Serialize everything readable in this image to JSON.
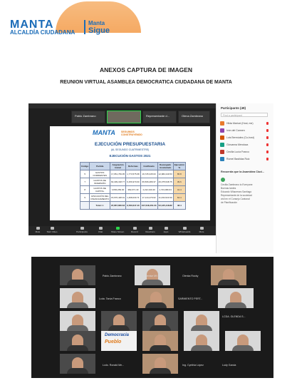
{
  "header": {
    "logo_text": "MANTA",
    "logo_sub": "ALCALDÍA CIUDADANA",
    "logo_tagline_1": "Manta",
    "logo_tagline_2": "Sigue"
  },
  "doc": {
    "title": "ANEXOS CAPTURA DE IMAGEN",
    "subtitle": "REUNION VIRTUAL ASAMBLEA DEMOCRATICA CIUDADANA DE MANTA"
  },
  "meeting1": {
    "top_tiles": [
      "Pablo Zambrano",
      "",
      "Representante d...",
      "Olena Zambrano"
    ],
    "slide": {
      "logo": "MANTA",
      "logo_sub": "ALCALDÍA",
      "tagline": "SEGUIMOS CONSTRUYENDO",
      "heading": "EJECUCIÓN PRESUPUESTARIA",
      "sub": "(AL SEGUNDO CUATRIMESTRE)",
      "section": "EJECUCIÓN GASTOS 2021",
      "table": {
        "headers": [
          "Código",
          "Partida",
          "Asignación Inicial",
          "Reformas",
          "Codificado",
          "Devengado Acumulado",
          "Ejecución %"
        ],
        "rows": [
          [
            "5",
            "GASTOS CORRIENTES",
            "17,951,769.95",
            "1,773,575.68",
            "19,725,345.63",
            "12,982,249.53",
            "65.8"
          ],
          [
            "7",
            "GASTOS DE INVERSIÓN",
            "60,409,318.77",
            "6,156,970.60",
            "66,566,289.37",
            "26,375,548.75",
            "39.6"
          ],
          [
            "8",
            "GASTOS DE CAPITAL",
            "3,830,269.00",
            "382,071.40",
            "4,212,340.40",
            "1,743,096.64",
            "41.4"
          ],
          [
            "9",
            "APLICACIÓN DEL FINANCIAMIENTO",
            "15,676,448.91",
            "1,468,030.71",
            "17,144,479.62",
            "11,034,523.90",
            "64.4"
          ]
        ],
        "total": [
          "",
          "Total >>",
          "97,867,806.63",
          "9,780,647.40",
          "107,648,454.03",
          "52,135,418.82",
          "48.4"
        ]
      }
    },
    "toolbar": [
      "Mute",
      "Start Video",
      "Participants",
      "Chat",
      "Share Screen",
      "Record",
      "Reactions",
      "Apps",
      "Whiteboards",
      "More"
    ],
    "end_label": "End",
    "panel": {
      "title": "Participants (49)",
      "search_placeholder": "Find a participant",
      "participants": [
        "Hilda Mariuxi (Host, me)",
        "Ivón del Carmen",
        "Luis Bermúdez (Co-host)",
        "Giovanna Mendoza",
        "Cecilia Lucía Franco",
        "Romel Bastidas Ruiz"
      ],
      "chat_title": "Recuerda que la Asamblea Ciud...",
      "chat_messages": [
        "Cecilia Zambrano to Everyone:",
        "Buenas tardes",
        "Eduardo Villacreses Santiago",
        "Representante de la sociedad",
        "civil en el Consejo Cantonal",
        "de Planificación"
      ]
    }
  },
  "meeting2": {
    "names": [
      "Pablo Zambrano",
      "Denise MV",
      "Olenka Rocky",
      "Lcda. Tanía Franco",
      "SARMIENTO PERT...",
      "LCDA. GLENDA S...",
      "Lcanda Zambrano",
      "",
      "Lcdo. Ronald Me...",
      "Ing. Cynthia López",
      "Ludy Garcia"
    ],
    "poster_line1": "Democracia",
    "poster_line2": "Pueblo"
  }
}
